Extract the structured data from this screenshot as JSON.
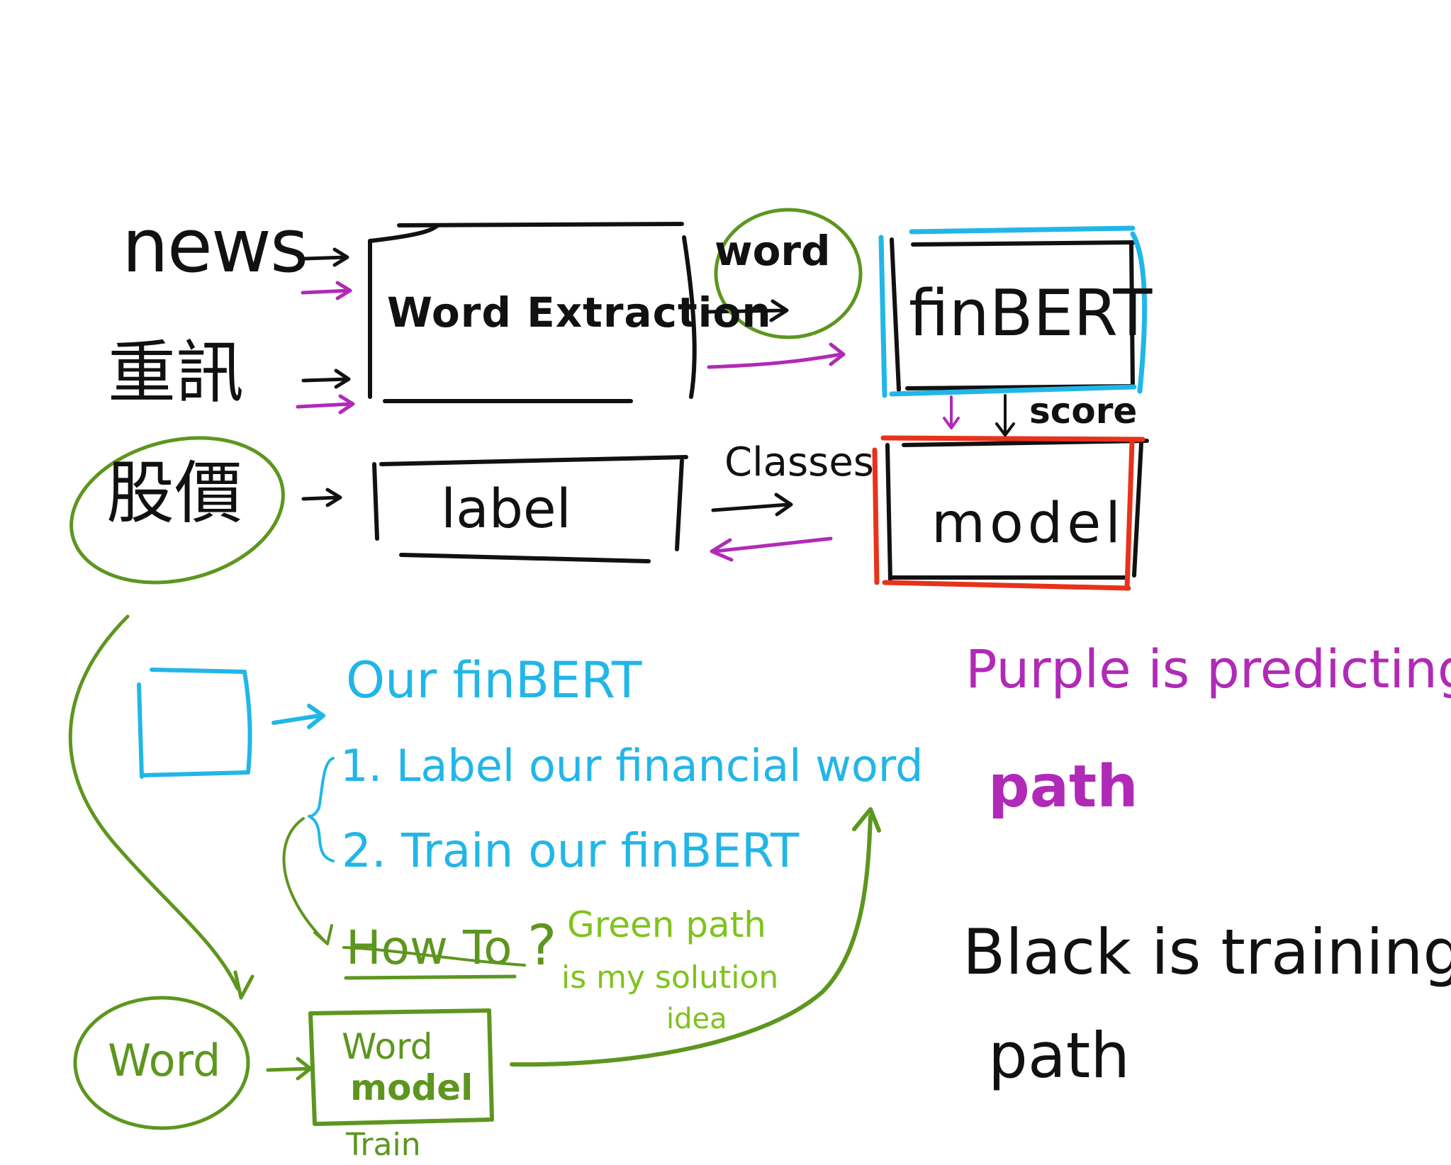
{
  "colors": {
    "black": "#111111",
    "green": "#5d961f",
    "light_green": "#7fc31c",
    "cyan": "#22b6e8",
    "purple": "#b02ab7",
    "red": "#e8321b"
  },
  "inputs": {
    "news": "news",
    "announcement": "重訊",
    "stock_price": "股價"
  },
  "boxes": {
    "word_extraction": "Word Extraction",
    "label": "label",
    "finbert": "finBERT",
    "model": "model"
  },
  "edges": {
    "word": "word",
    "score": "score",
    "classes": "Classes"
  },
  "plan": {
    "our_finbert": "Our finBERT",
    "step1": "1. Label our financial word",
    "step2": "2. Train our finBERT",
    "how_to": "How To",
    "question_mark": "?",
    "green_path_line1": "Green path",
    "green_path_line2": "is my solution",
    "green_path_line3": "idea"
  },
  "solution": {
    "word": "Word",
    "word_model_line1": "Word",
    "word_model_line2": "model",
    "train": "Train"
  },
  "legend": {
    "purple_line1": "Purple is predicting",
    "purple_line2": "path",
    "black_line1": "Black is training",
    "black_line2": "path"
  }
}
